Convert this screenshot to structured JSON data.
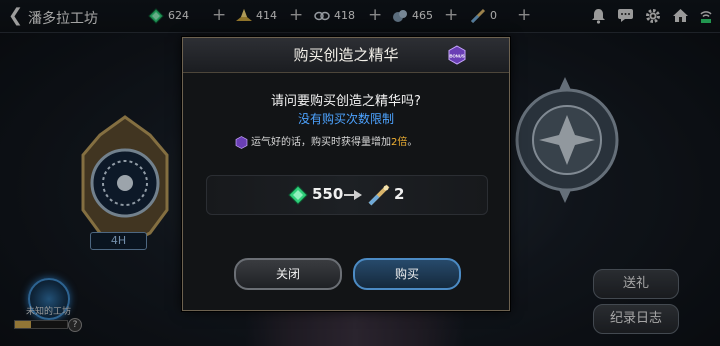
{
  "header": {
    "title": "潘多拉工坊",
    "resources": [
      {
        "icon": "green-gem-icon",
        "value": "624"
      },
      {
        "icon": "gold-crystal-icon",
        "value": "414"
      },
      {
        "icon": "infinity-ring-icon",
        "value": "418"
      },
      {
        "icon": "stone-ore-icon",
        "value": "465"
      },
      {
        "icon": "creation-essence-icon",
        "value": "0"
      }
    ],
    "plus": "+"
  },
  "background": {
    "timer_tag": "4H",
    "portal_label": "未知的工坊",
    "progress": 0.3,
    "help": "?",
    "gift_button": "送礼",
    "log_button": "纪录日志"
  },
  "modal": {
    "title": "购买创造之精华",
    "bonus_badge": "BONUS",
    "question": "请问要购买创造之精华吗?",
    "limit": "没有购买次数限制",
    "luck_prefix": "运气好的话，购买时获得量增加",
    "luck_multiplier": "2倍",
    "luck_suffix": "。",
    "cost": "550",
    "reward": "2",
    "close_button": "关闭",
    "buy_button": "购买"
  },
  "colors": {
    "accent_blue": "#4da3ff",
    "highlight_gold": "#f2b233",
    "bonus_purple": "#6a3fb5"
  }
}
